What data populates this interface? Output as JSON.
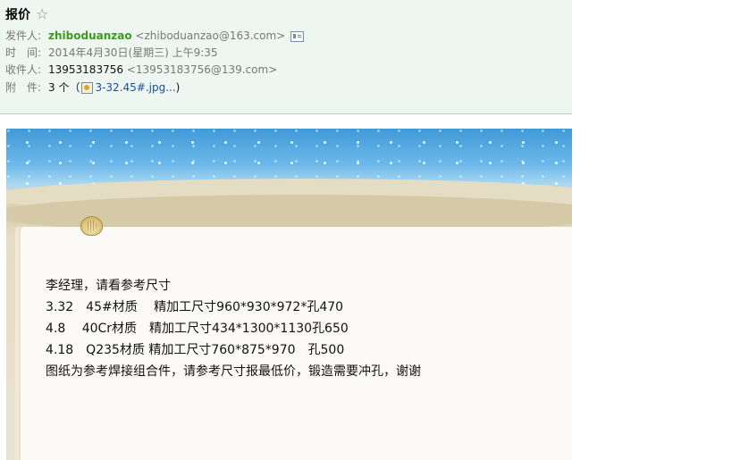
{
  "header": {
    "subject": "报价",
    "sender_label": "发件人:",
    "sender_name": "zhiboduanzao",
    "sender_email": "<zhiboduanzao@163.com>",
    "time_label": "时　间:",
    "time_value": "2014年4月30日(星期三) 上午9:35",
    "recipient_label": "收件人:",
    "recipient_name": "13953183756",
    "recipient_email": "<13953183756@139.com>",
    "attachment_label": "附　件:",
    "attachment_count": "3 个（",
    "attachment_file": "3-32.45#.jpg...",
    "attachment_close": ")"
  },
  "body": {
    "lines": [
      "李经理，请看参考尺寸",
      "3.32　45#材质　 精加工尺寸960*930*972*孔470",
      "4.8　 40Cr材质　精加工尺寸434*1300*1130孔650",
      "4.18　Q235材质 精加工尺寸760*875*970　孔500",
      "图纸为参考焊接组合件，请参考尺寸报最低价，锻造需要冲孔，谢谢"
    ]
  },
  "icons": {
    "star": "star-icon",
    "contact": "contact-card-icon",
    "attachment": "image-file-icon",
    "decoration": "seashell-icon"
  },
  "colors": {
    "header_bg": "#eef6f2",
    "sender_name": "#3b9a1e",
    "link": "#1a4fa0",
    "sky": "#3f9ad8"
  }
}
